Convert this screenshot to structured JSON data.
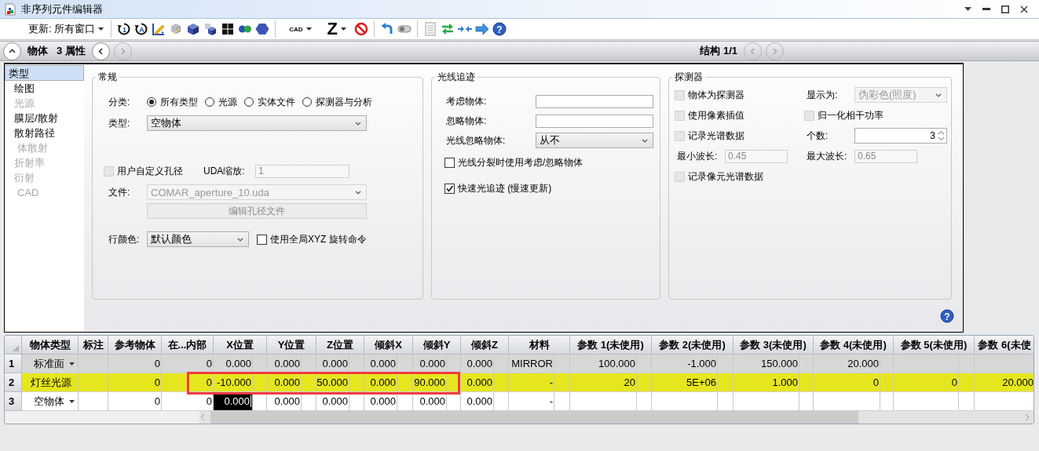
{
  "window": {
    "title": "非序列元件编辑器"
  },
  "toolbar": [
    {
      "kind": "menu",
      "label": "更新: 所有窗口"
    },
    {
      "kind": "separator"
    },
    {
      "kind": "cycle",
      "glyph": "1"
    },
    {
      "kind": "cycle",
      "glyph": "A"
    },
    {
      "kind": "pencil"
    },
    {
      "kind": "faded-cube"
    },
    {
      "kind": "cube"
    },
    {
      "kind": "cubes"
    },
    {
      "kind": "grid"
    },
    {
      "kind": "dots"
    },
    {
      "kind": "hexagon"
    },
    {
      "kind": "separator"
    },
    {
      "kind": "small-menu",
      "label": "CAD"
    },
    {
      "kind": "big-menu",
      "label": "Z"
    },
    {
      "kind": "no-sign"
    },
    {
      "kind": "separator"
    },
    {
      "kind": "undo"
    },
    {
      "kind": "toggle"
    },
    {
      "kind": "separator"
    },
    {
      "kind": "document"
    },
    {
      "kind": "swap"
    },
    {
      "kind": "converge"
    },
    {
      "kind": "arrow"
    },
    {
      "kind": "help",
      "glyph": "?"
    }
  ],
  "navigation": {
    "left": [
      {
        "kind": "collapse",
        "disabled": false
      },
      {
        "kind": "title",
        "label": "物体"
      },
      {
        "kind": "title",
        "label": "3 属性"
      },
      {
        "kind": "prev",
        "disabled": false
      },
      {
        "kind": "next",
        "disabled": true
      }
    ],
    "right": [
      {
        "kind": "title",
        "label": "结构 1/1"
      },
      {
        "kind": "prev",
        "disabled": true
      },
      {
        "kind": "next",
        "disabled": true
      }
    ]
  },
  "sidebar": {
    "items": [
      {
        "label": "类型",
        "selected": true,
        "disabled": false,
        "indented": false
      },
      {
        "label": "绘图",
        "selected": false,
        "disabled": false,
        "indented": false
      },
      {
        "label": "光源",
        "selected": false,
        "disabled": true,
        "indented": false
      },
      {
        "label": "膜层/散射",
        "selected": false,
        "disabled": false,
        "indented": false
      },
      {
        "label": "散射路径",
        "selected": false,
        "disabled": false,
        "indented": false
      },
      {
        "label": "体散射",
        "selected": false,
        "disabled": true,
        "indented": true
      },
      {
        "label": "折射率",
        "selected": false,
        "disabled": true,
        "indented": false
      },
      {
        "label": "衍射",
        "selected": false,
        "disabled": true,
        "indented": false
      },
      {
        "label": "CAD",
        "selected": false,
        "disabled": true,
        "indented": true
      }
    ]
  },
  "groups": [
    {
      "title": "常规",
      "rows": [
        {
          "controls": [
            {
              "kind": "radios",
              "label": "分类:",
              "options": [
                {
                  "label": "所有类型",
                  "selected": true
                },
                {
                  "label": "光源",
                  "selected": false
                },
                {
                  "label": "实体文件",
                  "selected": false
                },
                {
                  "label": "探测器与分析",
                  "selected": false
                }
              ]
            }
          ]
        },
        {
          "controls": [
            {
              "kind": "select",
              "label": "类型:",
              "value": "空物体",
              "disabled": false
            }
          ]
        },
        {
          "controls": [
            {
              "kind": "checkbox",
              "label": "用户自定义孔径",
              "checked": false,
              "disabled": true
            },
            {
              "kind": "field",
              "label": "UDA缩放:",
              "value": "1",
              "disabled": true
            }
          ]
        },
        {
          "controls": [
            {
              "kind": "select",
              "label": "文件:",
              "value": "COMAR_aperture_10.uda",
              "disabled": true
            }
          ]
        },
        {
          "controls": [
            {
              "kind": "button",
              "label": "编辑孔径文件",
              "disabled": true
            }
          ]
        },
        {
          "controls": [
            {
              "kind": "select",
              "label": "行颜色:",
              "value": "默认颜色",
              "disabled": false
            },
            {
              "kind": "checkbox",
              "label": "使用全局XYZ 旋转命令",
              "checked": false,
              "disabled": false
            }
          ]
        }
      ]
    },
    {
      "title": "光线追迹",
      "rows": [
        {
          "controls": [
            {
              "kind": "field",
              "label": "考虑物体:",
              "disabled": false
            }
          ]
        },
        {
          "controls": [
            {
              "kind": "field",
              "label": "忽略物体:",
              "disabled": false
            }
          ]
        },
        {
          "controls": [
            {
              "kind": "select",
              "label": "光线忽略物体:",
              "value": "从不",
              "disabled": false
            }
          ]
        },
        {
          "controls": [
            {
              "kind": "checkbox",
              "label": "光线分裂时使用考虑/忽略物体",
              "checked": false,
              "disabled": false
            }
          ]
        },
        {
          "controls": [
            {
              "kind": "checkbox",
              "label": "快速光追迹 (慢速更新)",
              "checked": true,
              "disabled": false
            }
          ]
        }
      ]
    },
    {
      "title": "探测器",
      "rows": [
        {
          "controls": [
            {
              "kind": "checkbox",
              "label": "物体为探测器",
              "checked": false,
              "disabled": true
            },
            {
              "kind": "select",
              "label": "显示为:",
              "value": "伪彩色(照度)",
              "disabled": true
            }
          ]
        },
        {
          "controls": [
            {
              "kind": "checkbox",
              "label": "使用像素插值",
              "checked": false,
              "disabled": true
            },
            {
              "kind": "checkbox",
              "label": "归一化相干功率",
              "checked": false,
              "disabled": true
            }
          ]
        },
        {
          "controls": [
            {
              "kind": "checkbox",
              "label": "记录光谱数据",
              "checked": false,
              "disabled": true
            },
            {
              "kind": "spinner",
              "label": "个数:",
              "value": "3",
              "disabled": false
            }
          ]
        },
        {
          "controls": [
            {
              "kind": "field",
              "label": "最小波长:",
              "value": "0.45",
              "disabled": true
            },
            {
              "kind": "field",
              "label": "最大波长:",
              "value": "0.65",
              "disabled": true
            }
          ]
        },
        {
          "controls": [
            {
              "kind": "checkbox",
              "label": "记录像元光谱数据",
              "checked": false,
              "disabled": true
            }
          ]
        }
      ]
    }
  ],
  "help": {
    "glyph": "?"
  },
  "table": {
    "columns": [
      {
        "label": "物体类型",
        "kind": "type"
      },
      {
        "label": "标注",
        "kind": "plain"
      },
      {
        "label": "参考物体",
        "kind": "plain"
      },
      {
        "label": "在...内部",
        "kind": "plain"
      },
      {
        "label": "X位置",
        "kind": "value"
      },
      {
        "label": "Y位置",
        "kind": "value"
      },
      {
        "label": "Z位置",
        "kind": "value"
      },
      {
        "label": "倾斜X",
        "kind": "value"
      },
      {
        "label": "倾斜Y",
        "kind": "value"
      },
      {
        "label": "倾斜Z",
        "kind": "value"
      },
      {
        "label": "材料",
        "kind": "value"
      },
      {
        "label": "参数 1(未使用)",
        "kind": "value"
      },
      {
        "label": "参数 2(未使用)",
        "kind": "value"
      },
      {
        "label": "参数 3(未使用)",
        "kind": "value"
      },
      {
        "label": "参数 4(未使用)",
        "kind": "value"
      },
      {
        "label": "参数 5(未使用)",
        "kind": "value"
      },
      {
        "label": "参数 6(未使",
        "kind": "last"
      }
    ],
    "rows": [
      {
        "number": "1",
        "selected": false,
        "shaded": true,
        "cells": [
          {
            "text": "标准面",
            "selected": false
          },
          {
            "selected": false
          },
          {
            "text": "0",
            "selected": false
          },
          {
            "text": "0",
            "selected": false
          },
          {
            "text": "0.000",
            "selected": false
          },
          {
            "text": "0.000",
            "selected": false
          },
          {
            "text": "0.000",
            "selected": false
          },
          {
            "text": "0.000",
            "selected": false
          },
          {
            "text": "0.000",
            "selected": false
          },
          {
            "text": "0.000",
            "selected": false
          },
          {
            "text": "MIRROR",
            "selected": false
          },
          {
            "text": "100.000",
            "selected": false
          },
          {
            "text": "-1.000",
            "selected": false
          },
          {
            "text": "150.000",
            "selected": false
          },
          {
            "text": "20.000",
            "selected": false
          },
          {
            "selected": false
          },
          {
            "selected": false
          }
        ]
      },
      {
        "number": "2",
        "selected": true,
        "shaded": false,
        "cells": [
          {
            "text": "灯丝光源",
            "selected": false
          },
          {
            "selected": false
          },
          {
            "text": "0",
            "selected": false
          },
          {
            "text": "0",
            "selected": false
          },
          {
            "text": "-10.000",
            "selected": false
          },
          {
            "text": "0.000",
            "selected": false
          },
          {
            "text": "50.000",
            "selected": false
          },
          {
            "text": "0.000",
            "selected": false
          },
          {
            "text": "90.000",
            "selected": false
          },
          {
            "text": "0.000",
            "selected": false
          },
          {
            "text": "-",
            "selected": false
          },
          {
            "text": "20",
            "selected": false
          },
          {
            "text": "5E+06",
            "selected": false
          },
          {
            "text": "1.000",
            "selected": false
          },
          {
            "text": "0",
            "selected": false
          },
          {
            "text": "0",
            "selected": false
          },
          {
            "text": "20.000",
            "selected": false
          }
        ]
      },
      {
        "number": "3",
        "selected": false,
        "shaded": false,
        "cells": [
          {
            "text": "空物体",
            "selected": false
          },
          {
            "selected": false
          },
          {
            "text": "0",
            "selected": false
          },
          {
            "text": "0",
            "selected": false
          },
          {
            "text": "0.000",
            "selected": true
          },
          {
            "text": "0.000",
            "selected": false
          },
          {
            "text": "0.000",
            "selected": false
          },
          {
            "text": "0.000",
            "selected": false
          },
          {
            "text": "0.000",
            "selected": false
          },
          {
            "text": "0.000",
            "selected": false
          },
          {
            "text": "-",
            "selected": false
          },
          {
            "selected": false
          },
          {
            "selected": false
          },
          {
            "selected": false
          },
          {
            "selected": false
          },
          {
            "selected": false
          },
          {
            "selected": false
          }
        ]
      }
    ]
  },
  "annotations": [
    {
      "kind": "rectangle"
    }
  ]
}
